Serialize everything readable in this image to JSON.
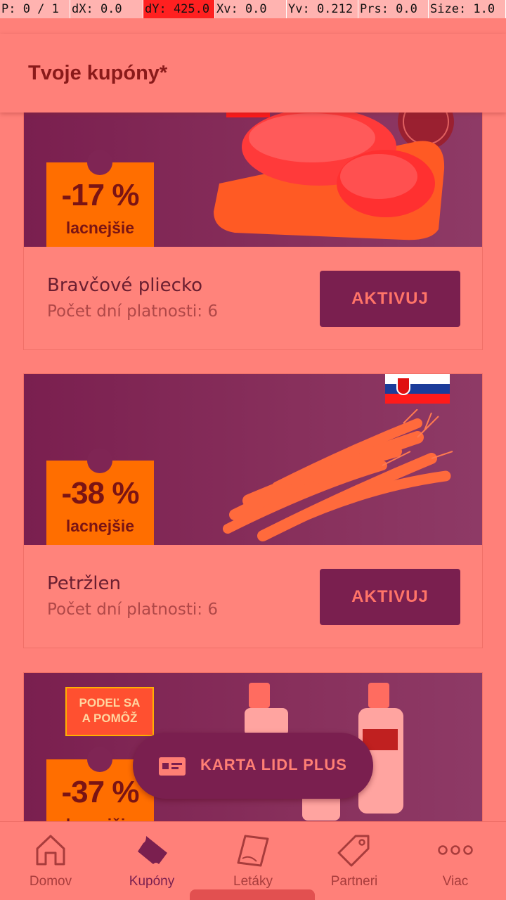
{
  "debug": {
    "pointer": "P: 0 / 1",
    "dx": "dX: 0.0",
    "dy": "dY: 425.0",
    "xv": "Xv: 0.0",
    "yv": "Yv: 0.212",
    "prs": "Prs: 0.0",
    "size": "Size: 1.0"
  },
  "header": {
    "title": "Tvoje kupóny*"
  },
  "coupons": [
    {
      "discount": "-17 %",
      "note": "lacnejšie",
      "name": "Bravčové pliecko",
      "validity": "Počet dní platnosti: 6",
      "button": "AKTIVUJ"
    },
    {
      "discount": "-38 %",
      "note": "lacnejšie",
      "name": "Petržlen",
      "validity": "Počet dní platnosti: 6",
      "button": "AKTIVUJ"
    },
    {
      "discount": "-37 %",
      "note": "lacnejšie",
      "promo_line1": "PODEĽ SA",
      "promo_line2": "A POMÔŽ"
    }
  ],
  "fab": {
    "label": "KARTA LIDL PLUS",
    "icon": "card-icon"
  },
  "nav": [
    {
      "label": "Domov",
      "icon": "home-icon",
      "active": false
    },
    {
      "label": "Kupóny",
      "icon": "coupon-icon",
      "active": true
    },
    {
      "label": "Letáky",
      "icon": "leaflet-icon",
      "active": false
    },
    {
      "label": "Partneri",
      "icon": "tag-icon",
      "active": false
    },
    {
      "label": "Viac",
      "icon": "more-icon",
      "active": false
    }
  ],
  "colors": {
    "accent": "#7a1f4f",
    "badge": "#ff6e00",
    "overlay": "#ff8079"
  }
}
